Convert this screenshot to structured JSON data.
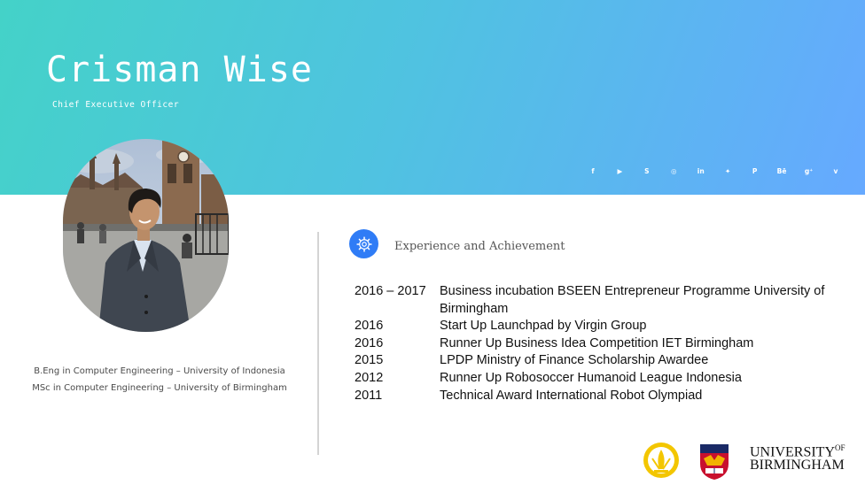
{
  "profile": {
    "name": "Crisman Wise",
    "role": "Chief Executive Officer"
  },
  "social_icons": [
    {
      "name": "facebook-icon",
      "glyph": "f"
    },
    {
      "name": "youtube-icon",
      "glyph": "▶"
    },
    {
      "name": "skype-icon",
      "glyph": "S"
    },
    {
      "name": "instagram-icon",
      "glyph": "◎"
    },
    {
      "name": "linkedin-icon",
      "glyph": "in"
    },
    {
      "name": "twitter-icon",
      "glyph": "✦"
    },
    {
      "name": "pinterest-icon",
      "glyph": "P"
    },
    {
      "name": "behance-icon",
      "glyph": "Bē"
    },
    {
      "name": "google-plus-icon",
      "glyph": "g⁺"
    },
    {
      "name": "vimeo-icon",
      "glyph": "v"
    }
  ],
  "education": {
    "line1": "B.Eng in Computer Engineering – University of Indonesia",
    "line2": "MSc in Computer Engineering – University of Birmingham"
  },
  "section": {
    "title": "Experience and Achievement",
    "icon": "gear-icon"
  },
  "achievements": [
    {
      "year": "2016 – 2017",
      "text": "Business incubation BSEEN Entrepreneur Programme University of Birmingham"
    },
    {
      "year": "2016",
      "text": "Start Up Launchpad by Virgin Group"
    },
    {
      "year": "2016",
      "text": "Runner Up Business Idea Competition IET Birmingham"
    },
    {
      "year": "2015",
      "text": "LPDP Ministry of Finance Scholarship Awardee"
    },
    {
      "year": "2012",
      "text": "Runner Up Robosoccer Humanoid League Indonesia"
    },
    {
      "year": "2011",
      "text": "Technical Award International Robot Olympiad"
    }
  ],
  "university": {
    "line1": "UNIVERSITY",
    "of": "OF",
    "line2": "BIRMINGHAM"
  },
  "colors": {
    "header_start": "#44d2c8",
    "header_end": "#66a9ff",
    "accent": "#2f7cf6"
  }
}
